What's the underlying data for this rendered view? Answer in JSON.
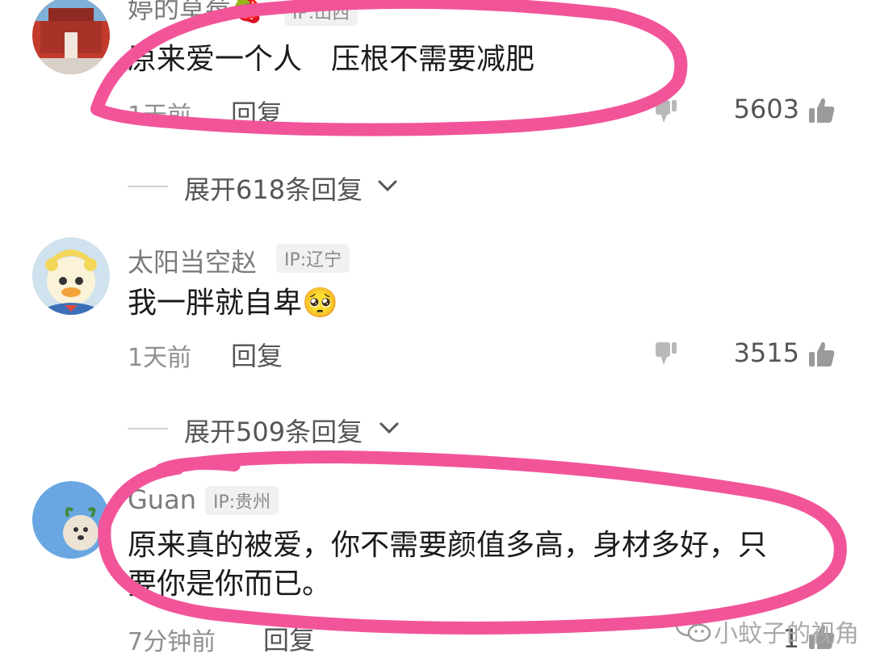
{
  "comments": [
    {
      "username": "婷的草莓",
      "username_emoji": "🍓",
      "ip": "IP:山西",
      "text": "原来爱一个人　压根不需要减肥",
      "time": "1天前",
      "reply_label": "回复",
      "likes": "5603"
    },
    {
      "username": "太阳当空赵",
      "ip": "IP:辽宁",
      "text": "我一胖就自卑",
      "emoji": "🥺",
      "time": "1天前",
      "reply_label": "回复",
      "likes": "3515"
    },
    {
      "username": "Guan",
      "ip": "IP:贵州",
      "text_line1": "原来真的被爱，你不需要颜值多高，身材多好，只",
      "text_line2": "要你是你而已。",
      "time": "7分钟前",
      "reply_label": "回复",
      "likes": "1"
    }
  ],
  "expand_replies": [
    {
      "label": "展开618条回复"
    },
    {
      "label": "展开509条回复"
    }
  ],
  "watermark": {
    "text": "小蚊子的视角",
    "icon": "wechat-icon"
  },
  "colors": {
    "highlight": "#f2549a",
    "badge_bg": "#f1f1f1"
  }
}
